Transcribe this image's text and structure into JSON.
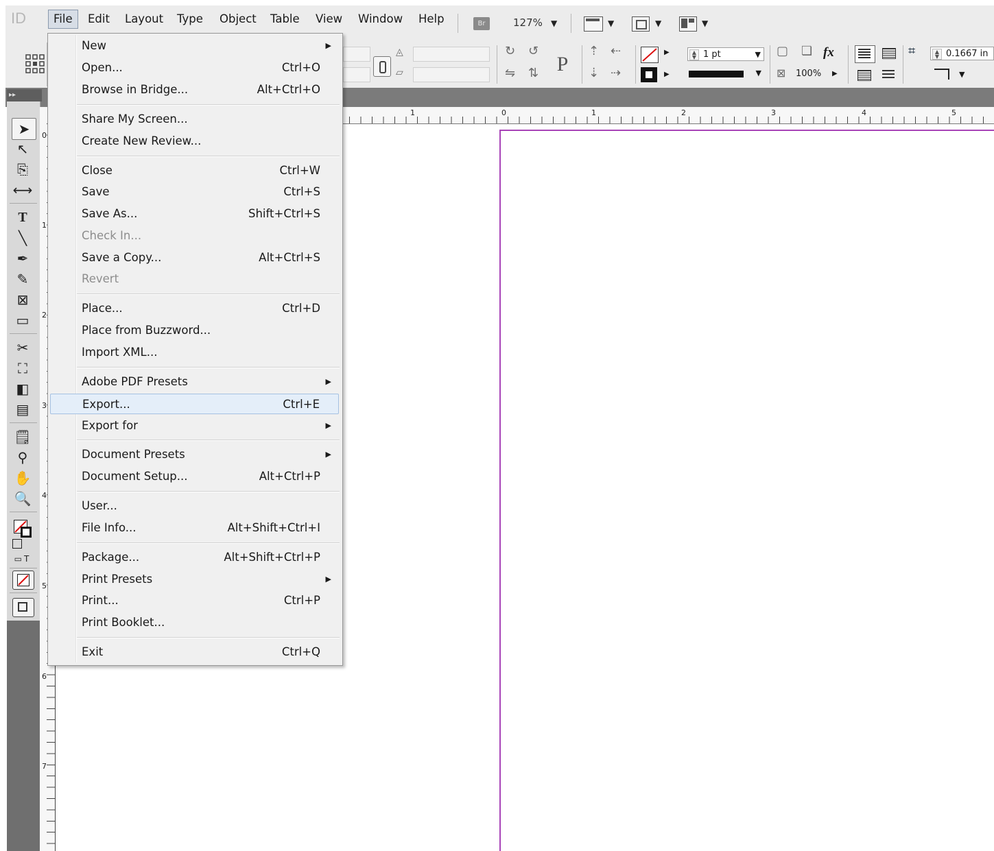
{
  "app": {
    "logo_text": "ID"
  },
  "menubar": {
    "items": [
      "File",
      "Edit",
      "Layout",
      "Type",
      "Object",
      "Table",
      "View",
      "Window",
      "Help"
    ],
    "bridge_label": "Br",
    "zoom": "127%"
  },
  "control_panel": {
    "stroke_weight": "1 pt",
    "opacity": "100%",
    "dimension": "0.1667 in"
  },
  "rulers": {
    "horizontal": [
      "1",
      "0",
      "1",
      "2",
      "3",
      "4",
      "5"
    ],
    "vertical": [
      "0",
      "1",
      "2",
      "3",
      "4",
      "5",
      "6",
      "7"
    ]
  },
  "file_menu": {
    "items": [
      {
        "label": "New",
        "shortcut": "",
        "submenu": true
      },
      {
        "label": "Open...",
        "shortcut": "Ctrl+O"
      },
      {
        "label": "Browse in Bridge...",
        "shortcut": "Alt+Ctrl+O"
      },
      {
        "label": "Share My Screen...",
        "shortcut": ""
      },
      {
        "label": "Create New Review...",
        "shortcut": ""
      },
      {
        "label": "Close",
        "shortcut": "Ctrl+W"
      },
      {
        "label": "Save",
        "shortcut": "Ctrl+S"
      },
      {
        "label": "Save As...",
        "shortcut": "Shift+Ctrl+S"
      },
      {
        "label": "Check In...",
        "shortcut": "",
        "disabled": true
      },
      {
        "label": "Save a Copy...",
        "shortcut": "Alt+Ctrl+S"
      },
      {
        "label": "Revert",
        "shortcut": "",
        "disabled": true
      },
      {
        "label": "Place...",
        "shortcut": "Ctrl+D"
      },
      {
        "label": "Place from Buzzword...",
        "shortcut": ""
      },
      {
        "label": "Import XML...",
        "shortcut": ""
      },
      {
        "label": "Adobe PDF Presets",
        "shortcut": "",
        "submenu": true
      },
      {
        "label": "Export...",
        "shortcut": "Ctrl+E",
        "highlighted": true
      },
      {
        "label": "Export for",
        "shortcut": "",
        "submenu": true
      },
      {
        "label": "Document Presets",
        "shortcut": "",
        "submenu": true
      },
      {
        "label": "Document Setup...",
        "shortcut": "Alt+Ctrl+P"
      },
      {
        "label": "User...",
        "shortcut": ""
      },
      {
        "label": "File Info...",
        "shortcut": "Alt+Shift+Ctrl+I"
      },
      {
        "label": "Package...",
        "shortcut": "Alt+Shift+Ctrl+P"
      },
      {
        "label": "Print Presets",
        "shortcut": "",
        "submenu": true
      },
      {
        "label": "Print...",
        "shortcut": "Ctrl+P"
      },
      {
        "label": "Print Booklet...",
        "shortcut": ""
      },
      {
        "label": "Exit",
        "shortcut": "Ctrl+Q"
      }
    ]
  }
}
